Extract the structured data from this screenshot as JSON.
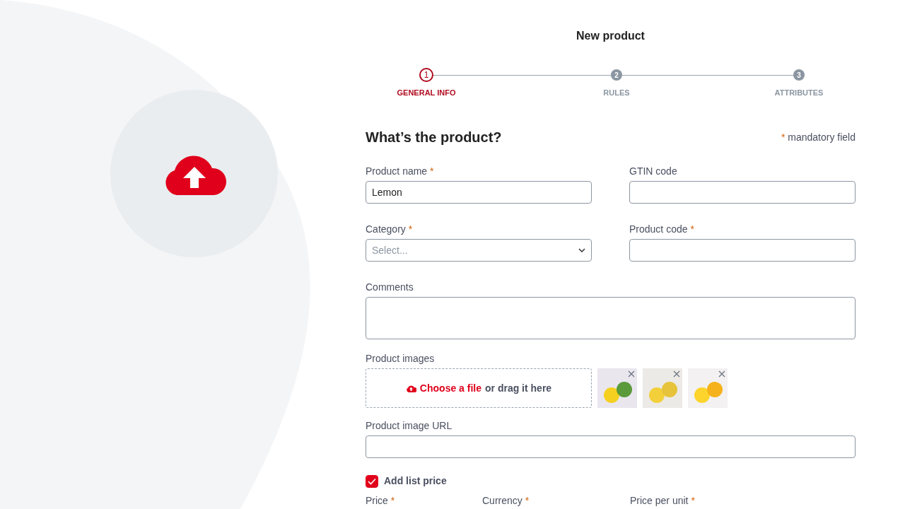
{
  "title": "New product",
  "steps": [
    {
      "number": "1",
      "label": "GENERAL INFO",
      "selected": true
    },
    {
      "number": "2",
      "label": "RULES",
      "selected": false
    },
    {
      "number": "3",
      "label": "ATTRIBUTES",
      "selected": false
    }
  ],
  "section": {
    "heading": "What’s the product?",
    "required_mark": "*",
    "required_note": "mandatory field"
  },
  "fields": [
    {
      "kind": "text",
      "label": "Product name",
      "required_mark": "*",
      "value": "Lemon"
    },
    {
      "kind": "text",
      "label": "GTIN code"
    },
    {
      "kind": "select",
      "label": "Category",
      "required_mark": "*",
      "placeholder": "Select..."
    },
    {
      "kind": "text",
      "label": "Product code",
      "required_mark": "*"
    },
    {
      "kind": "textarea",
      "label": "Comments"
    }
  ],
  "images": {
    "label": "Product images",
    "link": "Choose a file",
    "hint": "or drag it here",
    "thumbnails": [
      {
        "removable": true
      },
      {
        "removable": true
      },
      {
        "removable": true
      }
    ]
  },
  "url_field": {
    "label": "Product image URL"
  },
  "list_price": {
    "label": "Add list price",
    "checked": true
  },
  "price_fields": [
    {
      "label": "Price",
      "required_mark": "*"
    },
    {
      "label": "Currency",
      "required_mark": "*"
    },
    {
      "label": "Price per unit",
      "required_mark": "*"
    }
  ]
}
